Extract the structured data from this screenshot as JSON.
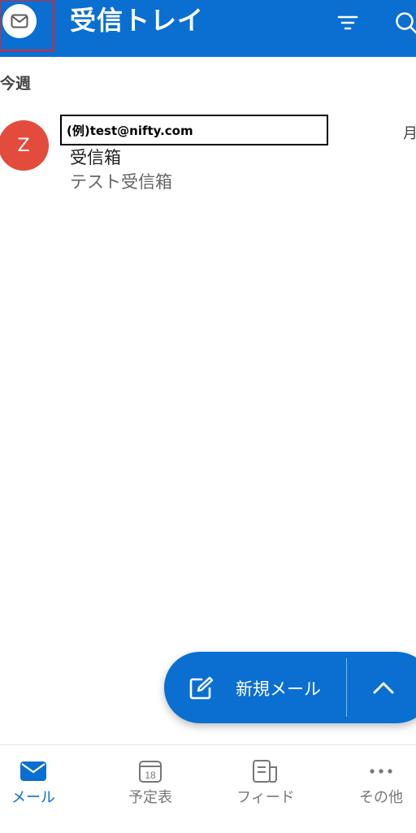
{
  "header": {
    "title": "受信トレイ",
    "account_icon": "mail-icon",
    "filter_icon": "filter-icon",
    "search_icon": "search-icon"
  },
  "section": {
    "label": "今週"
  },
  "messages": [
    {
      "avatar_letter": "Z",
      "sender": "(例)test@nifty.com",
      "date": "月",
      "subject": "受信箱",
      "preview": "テスト受信箱"
    }
  ],
  "fab": {
    "label": "新規メール",
    "compose_icon": "compose-icon",
    "expand_icon": "chevron-up-icon"
  },
  "bottom_nav": [
    {
      "label": "メール",
      "icon": "mail-icon",
      "active": true
    },
    {
      "label": "予定表",
      "icon": "calendar-icon",
      "badge": "18",
      "active": false
    },
    {
      "label": "フィード",
      "icon": "feed-icon",
      "active": false
    },
    {
      "label": "その他",
      "icon": "more-icon",
      "active": false
    }
  ],
  "colors": {
    "primary": "#0a6fd1",
    "avatar": "#e34b3c",
    "highlight_border": "#e3242b"
  }
}
